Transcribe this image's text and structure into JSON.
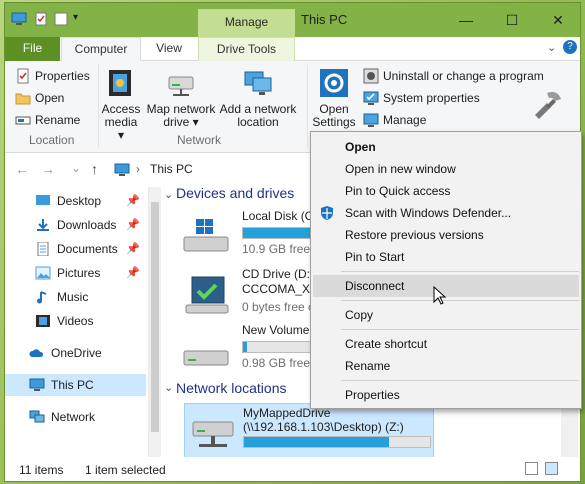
{
  "window": {
    "title": "This PC",
    "context_tab": "Manage",
    "controls": {
      "minimize": "—",
      "maximize": "☐",
      "close": "✕"
    }
  },
  "ribbon": {
    "tabs": [
      "File",
      "Computer",
      "View",
      "Drive Tools"
    ],
    "location": {
      "label": "Location",
      "properties": "Properties",
      "open": "Open",
      "rename": "Rename"
    },
    "network": {
      "label": "Network",
      "access_media_line1": "Access",
      "access_media_line2": "media ▾",
      "map_drive_line1": "Map network",
      "map_drive_line2": "drive ▾",
      "add_location_line1": "Add a network",
      "add_location_line2": "location"
    },
    "system": {
      "open_settings_line1": "Open",
      "open_settings_line2": "Settings",
      "uninstall": "Uninstall or change a program",
      "system_properties": "System properties",
      "manage": "Manage"
    }
  },
  "address": {
    "path": "This PC",
    "back": "←",
    "forward": "→",
    "dropdown": "⌄",
    "up": "↑",
    "sep": "›"
  },
  "nav": {
    "items": [
      {
        "label": "Desktop",
        "pinned": true
      },
      {
        "label": "Downloads",
        "pinned": true
      },
      {
        "label": "Documents",
        "pinned": true
      },
      {
        "label": "Pictures",
        "pinned": true
      },
      {
        "label": "Music",
        "pinned": false
      },
      {
        "label": "Videos",
        "pinned": false
      },
      {
        "label": "OneDrive",
        "pinned": false
      },
      {
        "label": "This PC",
        "pinned": false,
        "selected": true
      },
      {
        "label": "Network",
        "pinned": false
      }
    ],
    "pin_glyph": "📌"
  },
  "content": {
    "devices_header": "Devices and drives",
    "network_header": "Network locations",
    "drives": [
      {
        "name": "Local Disk (C:)",
        "free": "10.9 GB free of",
        "used_fraction": 0.82
      },
      {
        "name": "CD Drive (D:)",
        "name2": "CCCOMA_X86",
        "free": "0 bytes free of"
      },
      {
        "name": "New Volume (",
        "free": "0.98 GB free of",
        "used_fraction": 0.02
      }
    ],
    "mapped": {
      "name": "MyMappedDrive",
      "path": "(\\\\192.168.1.103\\Desktop) (Z:)",
      "used_fraction": 0.78
    }
  },
  "status": {
    "items": "11 items",
    "selected": "1 item selected"
  },
  "context_menu": {
    "items": [
      "Open",
      "Open in new window",
      "Pin to Quick access",
      "Scan with Windows Defender...",
      "Restore previous versions",
      "Pin to Start",
      "Disconnect",
      "Copy",
      "Create shortcut",
      "Rename",
      "Properties"
    ]
  },
  "colors": {
    "accent": "#5d8f24",
    "titlebar": "#83b347",
    "selection": "#cce8ff",
    "bar": "#26a0da"
  }
}
